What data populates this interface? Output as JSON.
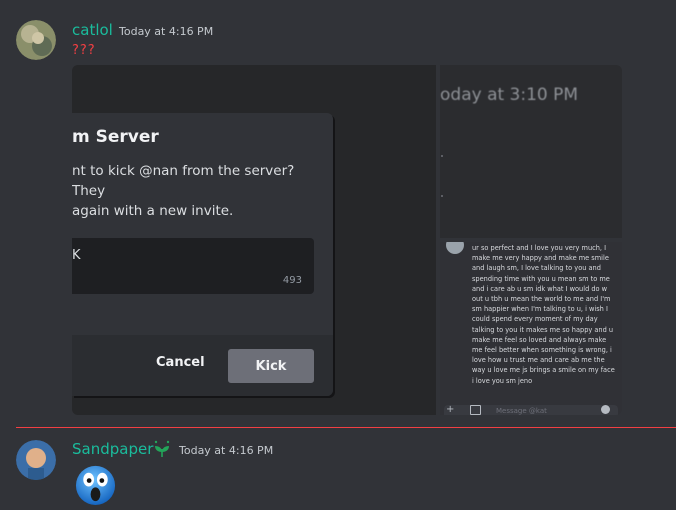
{
  "messages": [
    {
      "author": "catlol",
      "author_color": "#1abc9c",
      "timestamp": "Today at 4:16 PM",
      "content": "???",
      "embed": {
        "modal": {
          "title": "m Server",
          "body": "nt to kick @nan from the server? They again with a new invite.",
          "body_line1": "nt to kick @nan from the server? They",
          "body_line2": "again with a new invite.",
          "reason_value": "K",
          "char_count": "493",
          "cancel_label": "Cancel",
          "kick_label": "Kick"
        },
        "top_right_timestamp": "oday at 3:10 PM",
        "chat_text": "ur so perfect and I love you very much, I make me very happy and make me smile and laugh sm, I love talking to you and spending time with you u mean sm to me and i care ab u sm idk what I would do w out u tbh u mean the world to me and I'm sm happier when I'm talking to u, i wish I could spend every moment of my day talking to you it makes me so happy and u make me feel so loved and always make me feel better when something is wrong, i love how u trust me and care ab me the way u love me js brings a smile on my face i love you sm jeno",
        "input_placeholder": "Message @kat"
      }
    },
    {
      "author": "Sandpaper",
      "author_color": "#1abc9c",
      "timestamp": "Today at 4:16 PM",
      "badge_icon": "leaf-icon",
      "content_icon": "screaming-face-emoji"
    }
  ],
  "colors": {
    "background": "#313338",
    "new_message_divider": "#f23f43",
    "question_marks": "#f23f43"
  }
}
